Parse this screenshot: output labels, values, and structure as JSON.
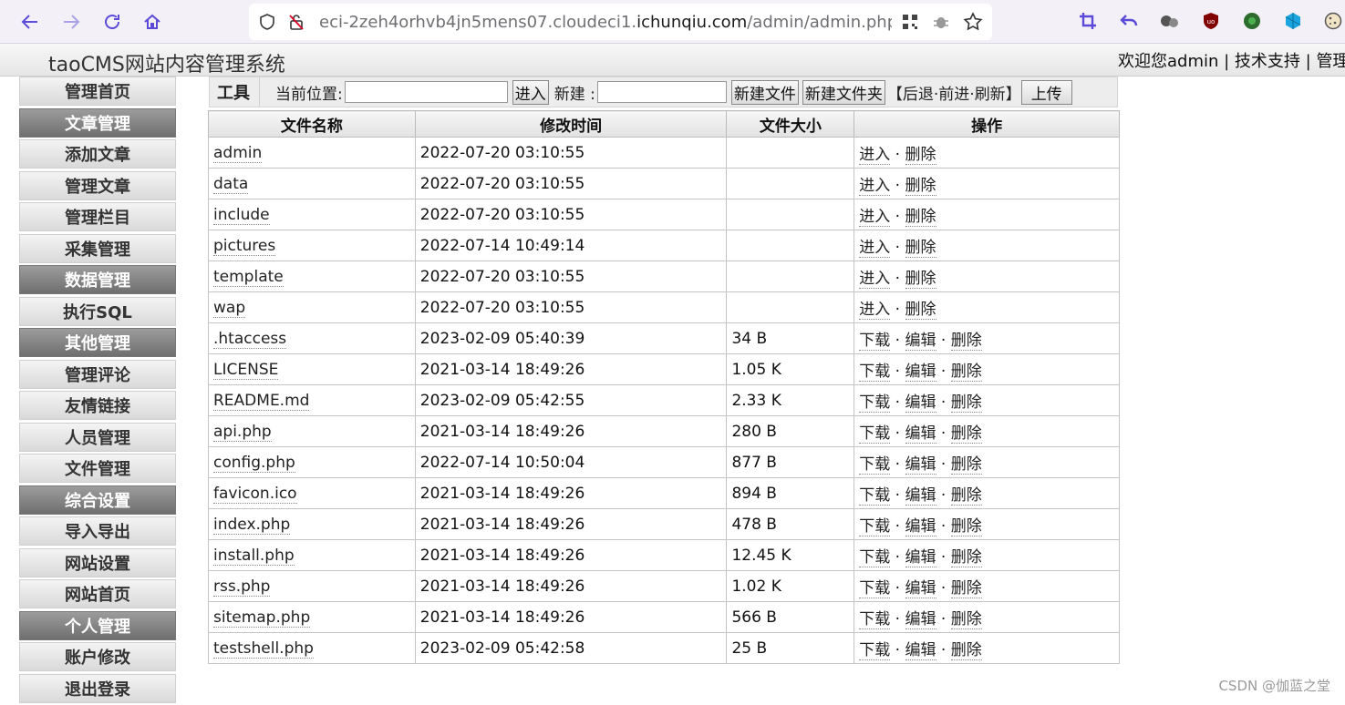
{
  "browser": {
    "url_prefix": "eci-2zeh4orhvb4jn5mens07.cloudeci1.",
    "url_domain": "ichunqiu.com",
    "url_suffix": "/admin/admin.php?actio",
    "accent_color": "#5b4bd8"
  },
  "header": {
    "title": "taoCMS网站内容管理系统",
    "welcome": "欢迎您admin",
    "sep1": " | ",
    "tech_support": "技术支持",
    "sep2": " | ",
    "admin_home": "管理首"
  },
  "sidebar": {
    "items": [
      {
        "label": "管理首页",
        "group": false
      },
      {
        "label": "文章管理",
        "group": true
      },
      {
        "label": "添加文章",
        "group": false
      },
      {
        "label": "管理文章",
        "group": false
      },
      {
        "label": "管理栏目",
        "group": false
      },
      {
        "label": "采集管理",
        "group": false
      },
      {
        "label": "数据管理",
        "group": true
      },
      {
        "label": "执行SQL",
        "group": false
      },
      {
        "label": "其他管理",
        "group": true
      },
      {
        "label": "管理评论",
        "group": false
      },
      {
        "label": "友情链接",
        "group": false
      },
      {
        "label": "人员管理",
        "group": false
      },
      {
        "label": "文件管理",
        "group": false
      },
      {
        "label": "综合设置",
        "group": true
      },
      {
        "label": "导入导出",
        "group": false
      },
      {
        "label": "网站设置",
        "group": false
      },
      {
        "label": "网站首页",
        "group": false
      },
      {
        "label": "个人管理",
        "group": true
      },
      {
        "label": "账户修改",
        "group": false
      },
      {
        "label": "退出登录",
        "group": false
      }
    ]
  },
  "toolbar": {
    "label": "工具",
    "location_label": "当前位置:",
    "location_value": "",
    "enter_button": "进入",
    "new_label": "新建 :",
    "new_value": "",
    "new_file_button": "新建文件",
    "new_folder_button": "新建文件夹",
    "bracket_open": "【",
    "back": "后退",
    "dot1": "·",
    "forward": "前进",
    "dot2": "·",
    "refresh": "刷新",
    "bracket_close": "】",
    "upload_button": "上传"
  },
  "table": {
    "columns": [
      "文件名称",
      "修改时间",
      "文件大小",
      "操作"
    ],
    "sep": " · ",
    "rows": [
      {
        "name": "admin",
        "time": "2022-07-20 03:10:55",
        "size": "",
        "actions": [
          "进入",
          "删除"
        ]
      },
      {
        "name": "data",
        "time": "2022-07-20 03:10:55",
        "size": "",
        "actions": [
          "进入",
          "删除"
        ]
      },
      {
        "name": "include",
        "time": "2022-07-20 03:10:55",
        "size": "",
        "actions": [
          "进入",
          "删除"
        ]
      },
      {
        "name": "pictures",
        "time": "2022-07-14 10:49:14",
        "size": "",
        "actions": [
          "进入",
          "删除"
        ]
      },
      {
        "name": "template",
        "time": "2022-07-20 03:10:55",
        "size": "",
        "actions": [
          "进入",
          "删除"
        ]
      },
      {
        "name": "wap",
        "time": "2022-07-20 03:10:55",
        "size": "",
        "actions": [
          "进入",
          "删除"
        ]
      },
      {
        "name": ".htaccess",
        "time": "2023-02-09 05:40:39",
        "size": "34 B",
        "actions": [
          "下载",
          "编辑",
          "删除"
        ]
      },
      {
        "name": "LICENSE",
        "time": "2021-03-14 18:49:26",
        "size": "1.05 K",
        "actions": [
          "下载",
          "编辑",
          "删除"
        ]
      },
      {
        "name": "README.md",
        "time": "2023-02-09 05:42:55",
        "size": "2.33 K",
        "actions": [
          "下载",
          "编辑",
          "删除"
        ]
      },
      {
        "name": "api.php",
        "time": "2021-03-14 18:49:26",
        "size": "280 B",
        "actions": [
          "下载",
          "编辑",
          "删除"
        ]
      },
      {
        "name": "config.php",
        "time": "2022-07-14 10:50:04",
        "size": "877 B",
        "actions": [
          "下载",
          "编辑",
          "删除"
        ]
      },
      {
        "name": "favicon.ico",
        "time": "2021-03-14 18:49:26",
        "size": "894 B",
        "actions": [
          "下载",
          "编辑",
          "删除"
        ]
      },
      {
        "name": "index.php",
        "time": "2021-03-14 18:49:26",
        "size": "478 B",
        "actions": [
          "下载",
          "编辑",
          "删除"
        ]
      },
      {
        "name": "install.php",
        "time": "2021-03-14 18:49:26",
        "size": "12.45 K",
        "actions": [
          "下载",
          "编辑",
          "删除"
        ]
      },
      {
        "name": "rss.php",
        "time": "2021-03-14 18:49:26",
        "size": "1.02 K",
        "actions": [
          "下载",
          "编辑",
          "删除"
        ]
      },
      {
        "name": "sitemap.php",
        "time": "2021-03-14 18:49:26",
        "size": "566 B",
        "actions": [
          "下载",
          "编辑",
          "删除"
        ]
      },
      {
        "name": "testshell.php",
        "time": "2023-02-09 05:42:58",
        "size": "25 B",
        "actions": [
          "下载",
          "编辑",
          "删除"
        ]
      }
    ]
  },
  "watermark": "CSDN @伽蓝之堂"
}
